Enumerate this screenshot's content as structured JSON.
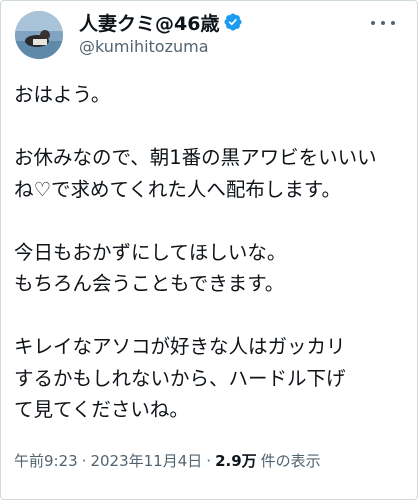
{
  "author": {
    "display_name": "人妻クミ@46歳",
    "handle": "@kumihitozuma",
    "verified": true,
    "verified_color": "#1d9bf0"
  },
  "icons": {
    "avatar": "avatar-photo",
    "verified": "verified-badge-icon",
    "more": "more-options-icon"
  },
  "tweet": {
    "lines": [
      "おはよう。",
      "",
      "お休みなので、朝1番の黒アワビをいいい",
      "ね♡で求めてくれた人へ配布します。",
      "",
      "今日もおかずにしてほしいな。",
      "もちろん会うこともできます。",
      "",
      "キレイなアソコが好きな人はガッカリ",
      "するかもしれないから、ハードル下げ",
      "て見てくださいね。"
    ]
  },
  "meta": {
    "time": "午前9:23",
    "separator": "·",
    "date": "2023年11月4日",
    "views_count": "2.9万",
    "views_label": "件の表示"
  }
}
